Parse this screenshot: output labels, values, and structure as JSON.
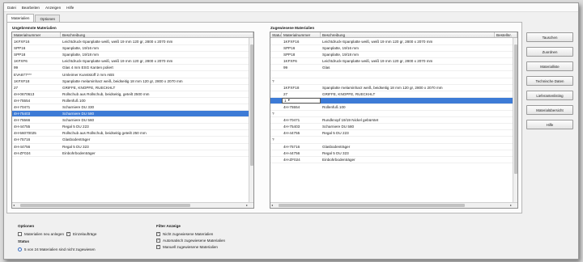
{
  "menu": [
    "Datei",
    "Bearbeiten",
    "Anzeigen",
    "Hilfe"
  ],
  "tabs": [
    {
      "label": "Materialien",
      "active": true
    },
    {
      "label": "Optionen",
      "active": false
    }
  ],
  "left": {
    "title": "Ungebremste Materialien",
    "columns": [
      "Materialnummer",
      "Beschreibung"
    ],
    "selected_index": 11,
    "rows": [
      [
        "1KFXF16",
        "Leichtdruck-Spanplatte weiß, weiß 19 mm 120 gr, 2800 x 2070 mm"
      ],
      [
        "SPP16",
        "Spanplatte, 19/16 mm"
      ],
      [
        "SPP18",
        "Spanplatte, 19/18 mm"
      ],
      [
        "1KFXF6",
        "Leichtdruck-Spanplatte weiß, weiß 19 mm 120 gr, 2800 x 2070 mm"
      ],
      [
        "99",
        "Glas 4 mm ESG Kanten poliert"
      ],
      [
        "EVA877***",
        "Umleimer Kunststoff 2 mm ABS"
      ],
      [
        "1KFXF18",
        "Spanplatte melaminharz weiß, beidseitig 18 mm 120 gr, 2800 x 2070 mm"
      ],
      [
        "27",
        "GRIFFE, KNOPFE, RUECKHLT"
      ],
      [
        "4H-0670613",
        "Rollschub aus Rollschub, beidseitig, geteilt 2500 mm"
      ],
      [
        "4H-75554",
        "Rollenfuß 100"
      ],
      [
        "4H-70471",
        "Scharniere DU 330"
      ],
      [
        "4H-75403",
        "Scharniere DU 580"
      ],
      [
        "4H-75566",
        "Scharniere DU 560"
      ],
      [
        "4H-44755",
        "Regal 5 DU 223"
      ],
      [
        "4H-56070025",
        "Rollschub aus Rollschub, beidseitig geteilt 250 mm"
      ],
      [
        "4H-75716",
        "Glasbodenträger"
      ],
      [
        "4H-44756",
        "Regal 5 DU 323"
      ],
      [
        "4H-ZF024",
        "Einbohrbodenträger"
      ]
    ]
  },
  "right": {
    "title": "Zugewiesene Materialien",
    "columns": [
      "Status",
      "Materialnummer",
      "Beschreibung",
      "Bestellnr."
    ],
    "edit_row_index": 9,
    "edit_value": "1",
    "rows": [
      [
        "",
        "1KFXF16",
        "Leichtdruck-Spanplatte weiß, weiß 19 mm 120 gr, 2800 x 2070 mm",
        ""
      ],
      [
        "",
        "SPP16",
        "Spanplatte, 19/16 mm",
        ""
      ],
      [
        "",
        "SPP18",
        "Spanplatte, 19/18 mm",
        ""
      ],
      [
        "",
        "1KFXF6",
        "Leichtdruck-Spanplatte weiß, weiß 19 mm 120 gr, 2800 x 2070 mm",
        ""
      ],
      [
        "",
        "99",
        "Glas",
        ""
      ],
      [
        "",
        "",
        "",
        ""
      ],
      [
        "?",
        "",
        "",
        ""
      ],
      [
        "",
        "1KFXF18",
        "Spanplatte melaminharz weiß, beidseitig 18 mm 120 gr, 2800 x 2070 mm",
        ""
      ],
      [
        "",
        "27",
        "GRIFFE, KNOPFE, RUECKHLT",
        ""
      ],
      [
        "",
        "",
        "",
        ""
      ],
      [
        "",
        "4H-75554",
        "Rollenfuß 100",
        ""
      ],
      [
        "?",
        "",
        "",
        ""
      ],
      [
        "",
        "4H-70471",
        "Rundknopf 19/19 Nickel gebürstet",
        ""
      ],
      [
        "",
        "4H-75403",
        "Scharniere DU 580",
        ""
      ],
      [
        "",
        "4H-44755",
        "Regal 5 DU 223",
        ""
      ],
      [
        "?",
        "",
        "",
        ""
      ],
      [
        "",
        "4H-75716",
        "Glasbodenträger",
        ""
      ],
      [
        "",
        "4H-44756",
        "Regal 5 DU 323",
        ""
      ],
      [
        "",
        "4H-ZF024",
        "Einbohrbodenträger",
        ""
      ]
    ]
  },
  "buttons": [
    "Tauschen",
    "Zuordnen",
    "Materialliste",
    "Technische Daten",
    "Lieferantenlisting",
    "Materialübersicht",
    "Hilfe"
  ],
  "options": {
    "title": "Optionen",
    "items": [
      {
        "label": "Materialien neu anlegen",
        "checked": false
      },
      {
        "label": "Einzelaufträge",
        "checked": true
      }
    ]
  },
  "status": {
    "title": "Status",
    "text": "5 von 24 Materialien sind nicht zugewiesen"
  },
  "filter": {
    "title": "Filter Anzeige",
    "items": [
      {
        "label": "Nicht zugewiesene Materialien",
        "checked": true
      },
      {
        "label": "Automatisch zugewiesene Materialien",
        "checked": true
      },
      {
        "label": "Manuell zugewiesene Materialien",
        "checked": true
      }
    ]
  }
}
